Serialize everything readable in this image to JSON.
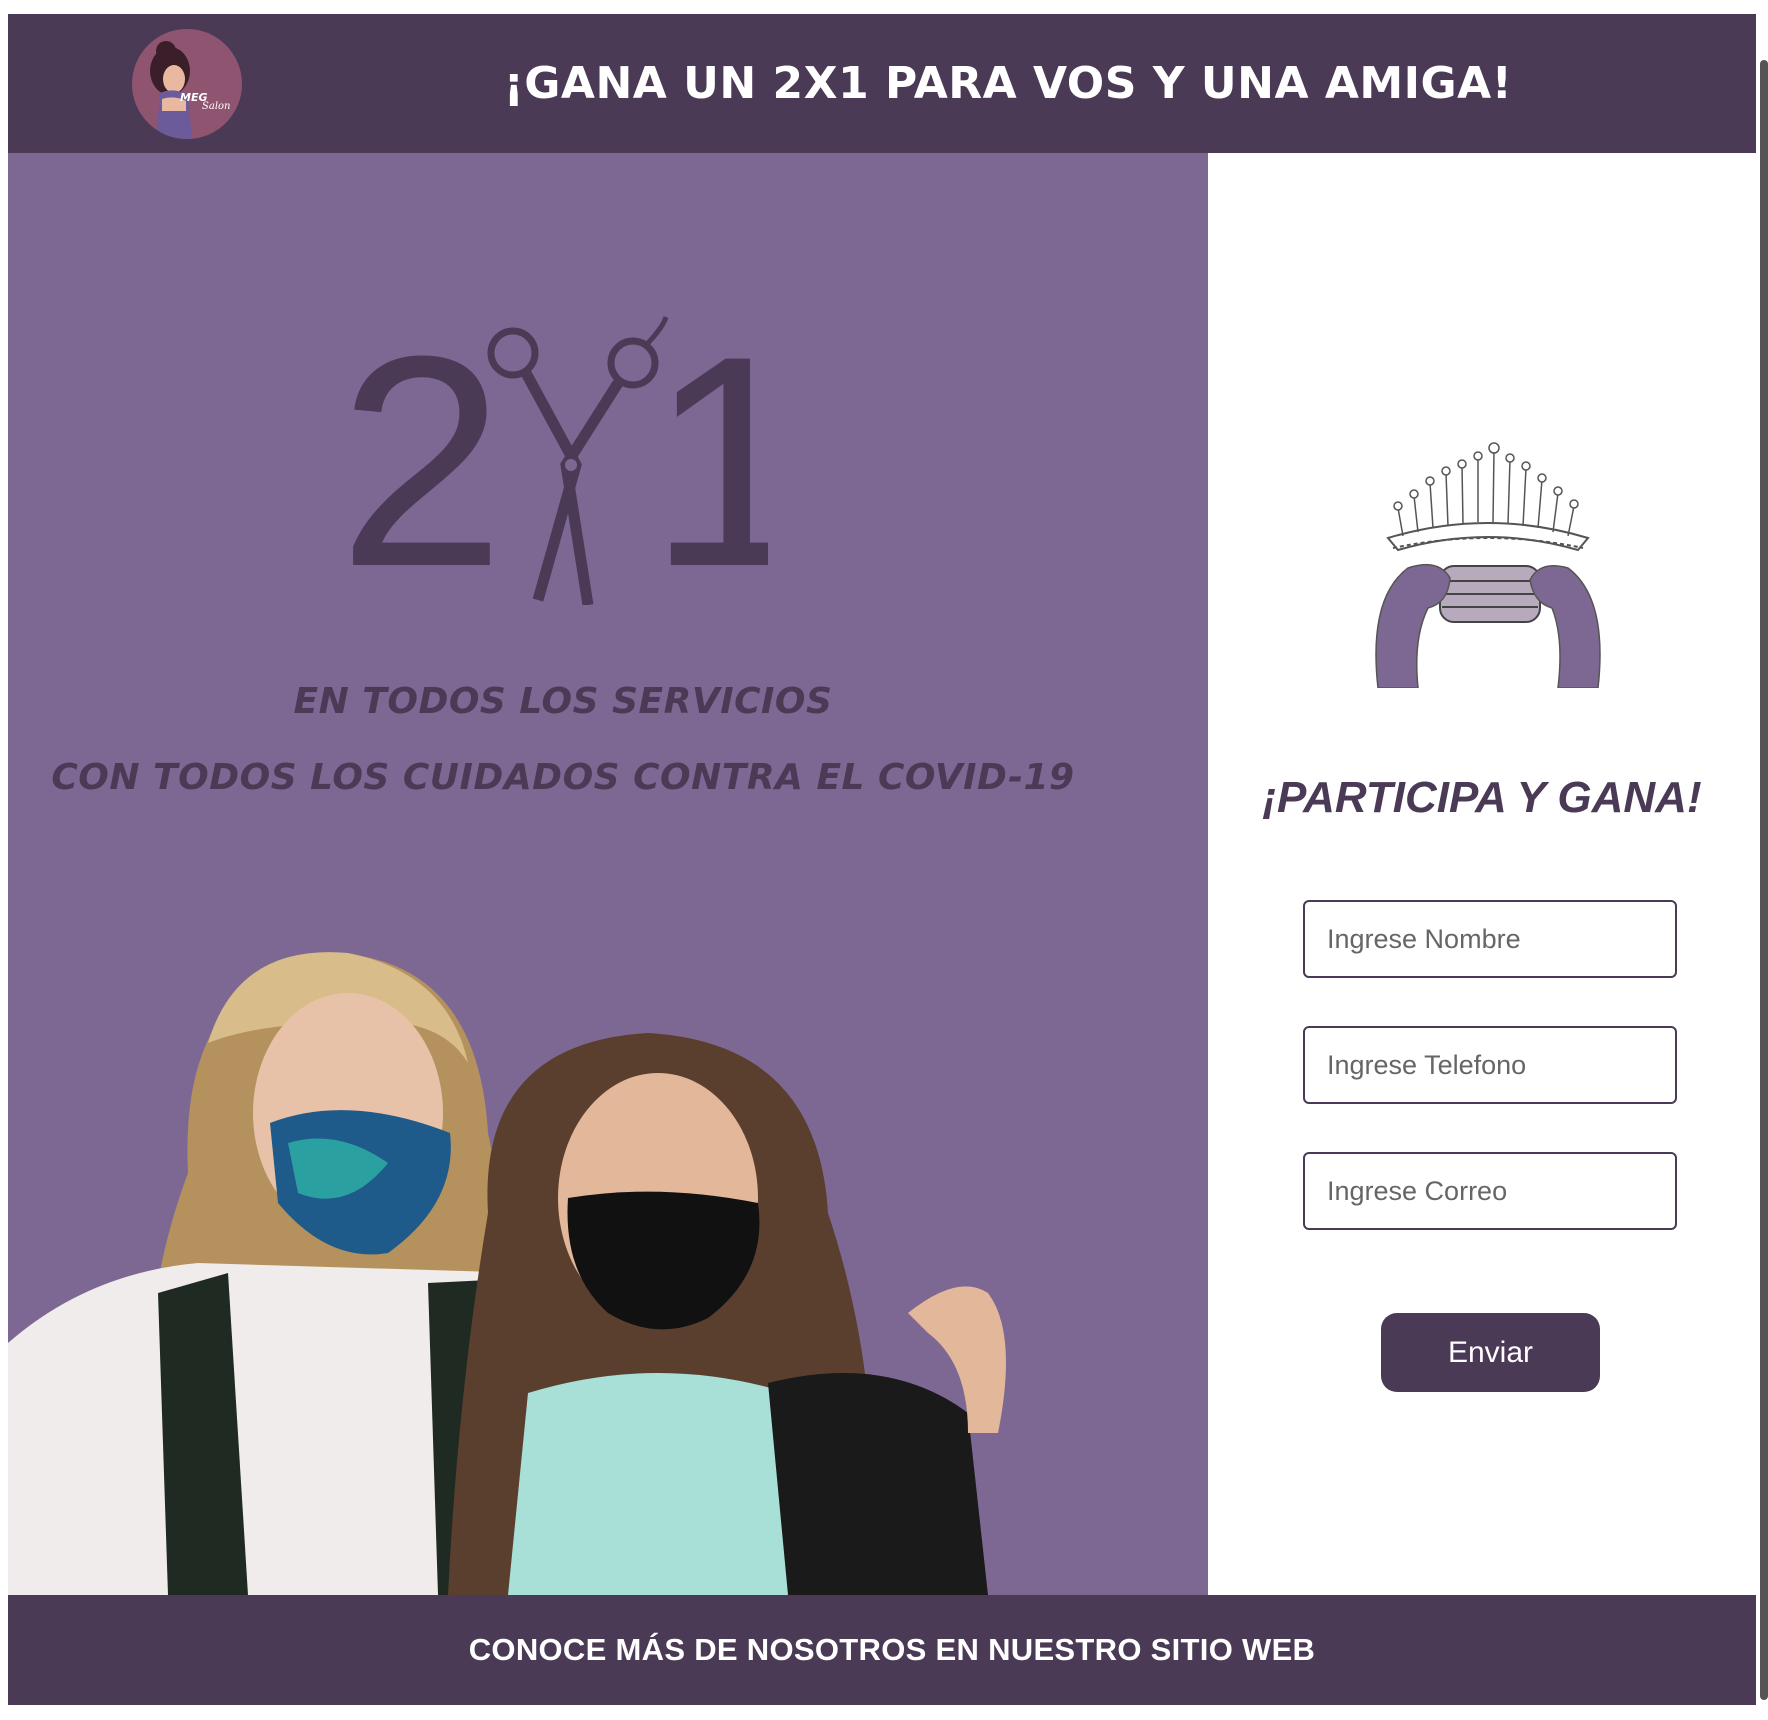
{
  "header": {
    "logo_name": "logo",
    "title": "¡GANA UN 2X1 PARA VOS Y UNA AMIGA!"
  },
  "promo": {
    "big_offer": {
      "left": "2",
      "right": "1"
    },
    "services_line": "EN TODOS LOS SERVICIOS",
    "covid_line": "CON TODOS LOS CUIDADOS CONTRA EL COVID-19"
  },
  "form": {
    "title": "¡PARTICIPA Y GANA!",
    "name_placeholder": "Ingrese Nombre",
    "phone_placeholder": "Ingrese Telefono",
    "email_placeholder": "Ingrese Correo",
    "submit_label": "Enviar"
  },
  "footer": {
    "link_text": "CONOCE MÁS DE NOSOTROS EN NUESTRO SITIO WEB"
  },
  "colors": {
    "header_bg": "#4a3a55",
    "promo_bg": "#7d6894",
    "accent": "#4a3a55"
  },
  "icons": [
    "logo",
    "scissors-icon",
    "crown-mask-illustration"
  ]
}
